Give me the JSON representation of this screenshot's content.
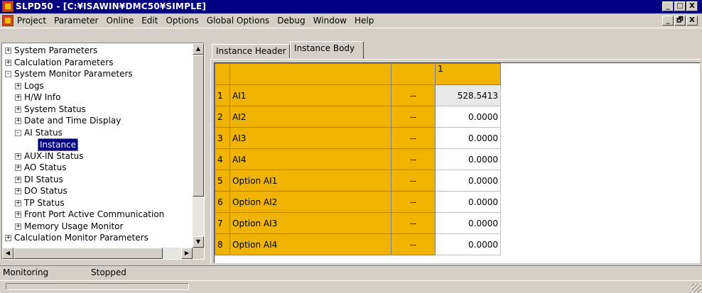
{
  "window": {
    "title": "SLPD50 - [C:¥ISAWIN¥DMC50¥SIMPLE]",
    "controls": [
      "_",
      "□",
      "X"
    ],
    "mdi_controls": [
      "_",
      "🗗",
      "X"
    ]
  },
  "menu": [
    "Project",
    "Parameter",
    "Online",
    "Edit",
    "Options",
    "Global Options",
    "Debug",
    "Window",
    "Help"
  ],
  "tree": {
    "nodes": [
      {
        "label": "System Parameters",
        "level": 0,
        "toggle": "+",
        "selected": false
      },
      {
        "label": "Calculation Parameters",
        "level": 0,
        "toggle": "+",
        "selected": false
      },
      {
        "label": "System Monitor Parameters",
        "level": 0,
        "toggle": "-",
        "selected": false
      },
      {
        "label": "Logs",
        "level": 1,
        "toggle": "+",
        "selected": false
      },
      {
        "label": "H/W Info",
        "level": 1,
        "toggle": "+",
        "selected": false
      },
      {
        "label": "System Status",
        "level": 1,
        "toggle": "+",
        "selected": false
      },
      {
        "label": "Date and Time Display",
        "level": 1,
        "toggle": "+",
        "selected": false
      },
      {
        "label": "AI Status",
        "level": 1,
        "toggle": "-",
        "selected": false
      },
      {
        "label": "Instance",
        "level": 2,
        "toggle": "",
        "selected": true
      },
      {
        "label": "AUX-IN Status",
        "level": 1,
        "toggle": "+",
        "selected": false
      },
      {
        "label": "AO Status",
        "level": 1,
        "toggle": "+",
        "selected": false
      },
      {
        "label": "DI Status",
        "level": 1,
        "toggle": "+",
        "selected": false
      },
      {
        "label": "DO Status",
        "level": 1,
        "toggle": "+",
        "selected": false
      },
      {
        "label": "TP Status",
        "level": 1,
        "toggle": "+",
        "selected": false
      },
      {
        "label": "Front Port Active Communication",
        "level": 1,
        "toggle": "+",
        "selected": false
      },
      {
        "label": "Memory Usage Monitor",
        "level": 1,
        "toggle": "+",
        "selected": false
      },
      {
        "label": "Calculation Monitor Parameters",
        "level": 0,
        "toggle": "+",
        "selected": false
      }
    ]
  },
  "tabs": [
    {
      "label": "Instance Header",
      "active": false
    },
    {
      "label": "Instance Body",
      "active": true
    }
  ],
  "grid": {
    "header": {
      "row": "",
      "name": "",
      "unit": "",
      "value": "1"
    },
    "rows": [
      {
        "num": "1",
        "name": "AI1",
        "unit": "--",
        "value": "528.5413"
      },
      {
        "num": "2",
        "name": "AI2",
        "unit": "--",
        "value": "0.0000"
      },
      {
        "num": "3",
        "name": "AI3",
        "unit": "--",
        "value": "0.0000"
      },
      {
        "num": "4",
        "name": "AI4",
        "unit": "--",
        "value": "0.0000"
      },
      {
        "num": "5",
        "name": "Option AI1",
        "unit": "--",
        "value": "0.0000"
      },
      {
        "num": "6",
        "name": "Option AI2",
        "unit": "--",
        "value": "0.0000"
      },
      {
        "num": "7",
        "name": "Option AI3",
        "unit": "--",
        "value": "0.0000"
      },
      {
        "num": "8",
        "name": "Option AI4",
        "unit": "--",
        "value": "0.0000"
      }
    ]
  },
  "status": {
    "mode": "Monitoring",
    "state": "Stopped"
  }
}
